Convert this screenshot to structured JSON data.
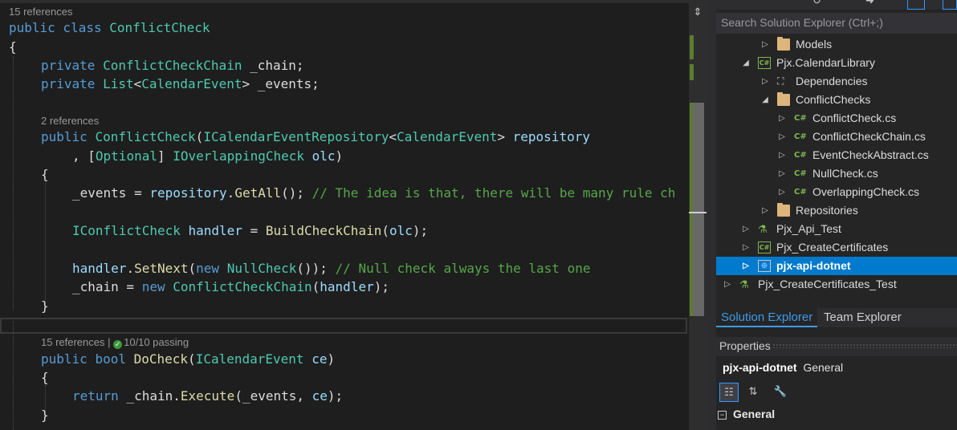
{
  "editor": {
    "lens_class_refs": "15 references",
    "lens_ctor_refs": "2 references",
    "lens_docheck_refs": "15 references",
    "lens_docheck_sep": " | ",
    "lens_docheck_tests": "10/10 passing",
    "code": {
      "l1": {
        "kw1": "public",
        "kw2": " class ",
        "type": "ConflictCheck"
      },
      "l2": "{",
      "l3": {
        "kw": "private ",
        "type": "ConflictCheckChain",
        "rest": " _chain;"
      },
      "l4": {
        "kw": "private ",
        "type1": "List",
        "p1": "<",
        "type2": "CalendarEvent",
        "p2": ">",
        "rest": " _events;"
      },
      "l5": {
        "kw": "public ",
        "type1": "ConflictCheck",
        "p1": "(",
        "type2": "ICalendarEventRepository",
        "p2": "<",
        "type3": "CalendarEvent",
        "p3": "> ",
        "param": "repository"
      },
      "l6": {
        "pre": ", [",
        "attr": "Optional",
        "mid": "] ",
        "type": "IOverlappingCheck",
        "sp": " ",
        "param": "olc",
        "post": ")"
      },
      "l7": "{",
      "l8": {
        "f1": "_events",
        "eq": " = ",
        "p": "repository",
        "dot": ".",
        "m": "GetAll",
        "call": "(); ",
        "comment": "// The idea is that, there will be many rule ch"
      },
      "l9": {
        "type": "IConflictCheck",
        "sp": " ",
        "var": "handler",
        "eq": " = ",
        "m": "BuildCheckChain",
        "op": "(",
        "arg": "olc",
        "cl": ");"
      },
      "l10": {
        "var": "handler",
        "dot": ".",
        "m": "SetNext",
        "op": "(",
        "kw": "new",
        "sp": " ",
        "type": "NullCheck",
        "cl": "()); ",
        "comment": "// Null check always the last one"
      },
      "l11": {
        "f": "_chain",
        "eq": " = ",
        "kw": "new",
        "sp": " ",
        "type": "ConflictCheckChain",
        "op": "(",
        "arg": "handler",
        "cl": ");"
      },
      "l12": "}",
      "l13": {
        "kw": "public ",
        "kw2": "bool ",
        "m": "DoCheck",
        "op": "(",
        "type": "ICalendarEvent",
        "sp": " ",
        "param": "ce",
        "cl": ")"
      },
      "l14": "{",
      "l15": {
        "kw": "return ",
        "f": "_chain",
        "dot": ".",
        "m": "Execute",
        "op": "(",
        "f2": "_events",
        "comma": ", ",
        "param": "ce",
        "cl": ");"
      },
      "l16": "}"
    }
  },
  "solution_explorer": {
    "search_placeholder": "Search Solution Explorer (Ctrl+;)",
    "items": [
      {
        "label": "Models",
        "icon": "folder-icon",
        "expander": "▷"
      },
      {
        "label": "Pjx.CalendarLibrary",
        "icon": "csharp-project-icon",
        "expander": "◢"
      },
      {
        "label": "Dependencies",
        "icon": "dependencies-icon",
        "expander": "▷"
      },
      {
        "label": "ConflictChecks",
        "icon": "folder-open-icon",
        "expander": "◢"
      },
      {
        "label": "ConflictCheck.cs",
        "icon": "csharp-file-icon",
        "expander": "▷"
      },
      {
        "label": "ConflictCheckChain.cs",
        "icon": "csharp-file-icon",
        "expander": "▷"
      },
      {
        "label": "EventCheckAbstract.cs",
        "icon": "csharp-file-icon",
        "expander": "▷"
      },
      {
        "label": "NullCheck.cs",
        "icon": "csharp-file-icon",
        "expander": "▷"
      },
      {
        "label": "OverlappingCheck.cs",
        "icon": "csharp-file-icon",
        "expander": "▷"
      },
      {
        "label": "Repositories",
        "icon": "folder-icon",
        "expander": "▷"
      },
      {
        "label": "Pjx_Api_Test",
        "icon": "test-project-icon",
        "expander": "▷"
      },
      {
        "label": "Pjx_CreateCertificates",
        "icon": "csharp-project-icon",
        "expander": "▷"
      },
      {
        "label": "pjx-api-dotnet",
        "icon": "web-project-icon",
        "expander": "▷"
      },
      {
        "label": "Pjx_CreateCertificates_Test",
        "icon": "test-project-icon",
        "expander": "▷"
      }
    ],
    "csharp_glyph": "C#",
    "tabs": {
      "solution": "Solution Explorer",
      "team": "Team Explorer"
    }
  },
  "properties": {
    "title": "Properties",
    "object_name": "pjx-api-dotnet",
    "object_type": "General",
    "category": "General",
    "category_toggle": "−"
  }
}
